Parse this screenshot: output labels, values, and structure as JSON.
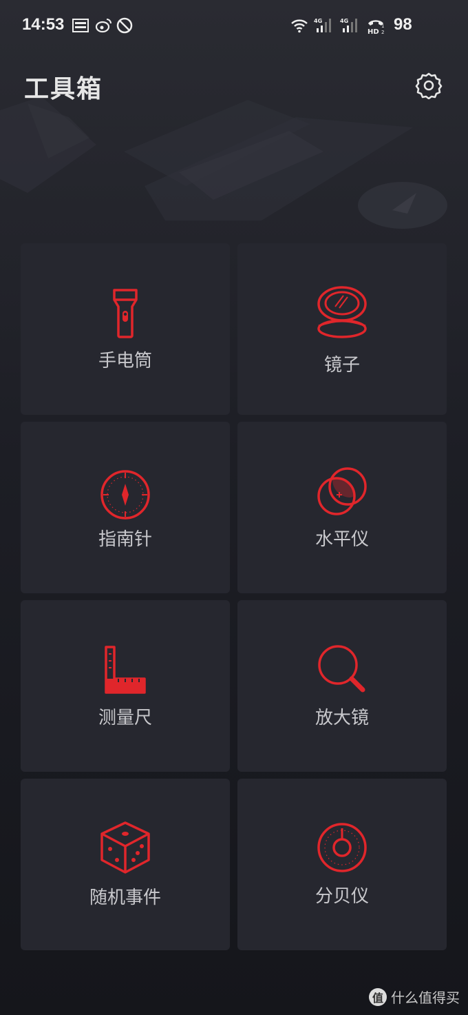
{
  "status_bar": {
    "time": "14:53",
    "battery": "98",
    "icons": [
      "toutiao-icon",
      "weibo-icon",
      "do-not-disturb-icon",
      "wifi-icon",
      "signal-4g-icon",
      "signal-4g-icon",
      "hd-call-icon"
    ]
  },
  "header": {
    "title": "工具箱",
    "settings_icon": "gear-icon"
  },
  "accent_color": "#e0262b",
  "tools": [
    {
      "label": "手电筒",
      "icon": "flashlight-icon"
    },
    {
      "label": "镜子",
      "icon": "mirror-icon"
    },
    {
      "label": "指南针",
      "icon": "compass-icon"
    },
    {
      "label": "水平仪",
      "icon": "level-icon"
    },
    {
      "label": "测量尺",
      "icon": "ruler-icon"
    },
    {
      "label": "放大镜",
      "icon": "magnifier-icon"
    },
    {
      "label": "随机事件",
      "icon": "dice-icon"
    },
    {
      "label": "分贝仪",
      "icon": "decibel-meter-icon"
    }
  ],
  "watermark": {
    "badge": "值",
    "text": "什么值得买"
  }
}
